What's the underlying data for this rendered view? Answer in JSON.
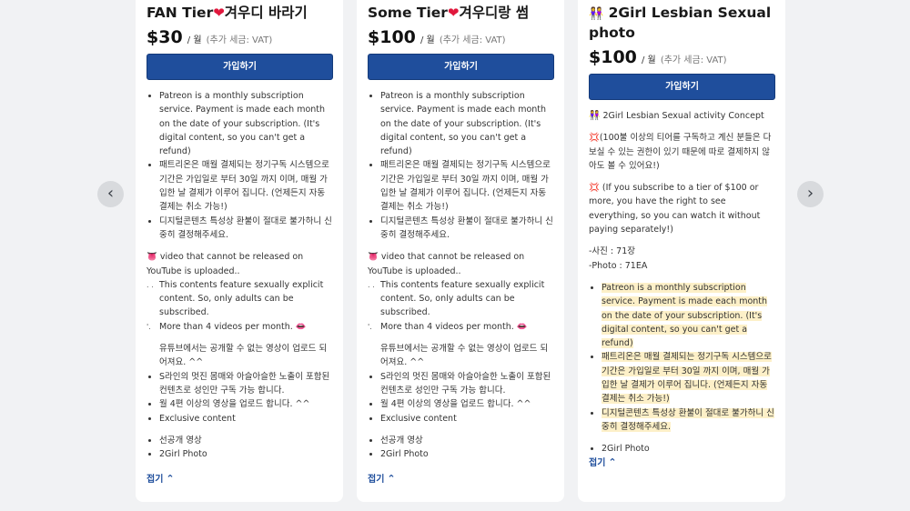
{
  "tiers": [
    {
      "title_text": "FAN Tier",
      "title_heart": "❤",
      "title_suffix": "겨우디 바라기",
      "price": "$30",
      "per": "/ 월",
      "vat": "(추가 세금: VAT)",
      "join_label": "가입하기",
      "bullets_a": [
        "Patreon is a monthly subscription service. Payment is made each month on the date of your subscription. (It's digital content, so you can't get a refund)",
        "패트리온은 매월 결제되는 정기구독 시스템으로 기간은 가입일로 부터 30일 까지 이며, 매월 가입한 날 결제가 이루어 집니다. (언제든지 자동결제는 취소 가능!)",
        "디지털콘텐츠 특성상 환불이 절대로 불가하니 신중히 결정해주세요."
      ],
      "video_line": " video that cannot be released on YouTube is uploaded..",
      "sub_a": "This contents feature sexually explicit content. So, only adults can be subscribed.",
      "sub_b": "More than 4 videos per month.",
      "korean_line": "유튜브에서는 공개할 수 없는  영상이 업로드 되어져요. ^^",
      "bullets_b": [
        "S라인의 멋진 몸매와 아슬아슬한 노출이 포함된 컨텐츠로 성인만 구독 가능 합니다.",
        "월 4편 이상의 영상을 업로드 합니다. ^^",
        "Exclusive content"
      ],
      "bullets_c": [
        "선공개 영상",
        "2Girl Photo"
      ],
      "collapse_label": "접기"
    },
    {
      "title_text": "Some Tier",
      "title_heart": "❤",
      "title_suffix": "겨우디랑 썸",
      "price": "$100",
      "per": "/ 월",
      "vat": "(추가 세금: VAT)",
      "join_label": "가입하기",
      "bullets_a": [
        "Patreon is a monthly subscription service. Payment is made each month on the date of your subscription. (It's digital content, so you can't get a refund)",
        "패트리온은 매월 결제되는 정기구독 시스템으로 기간은 가입일로 부터 30일 까지 이며, 매월 가입한 날 결제가 이루어 집니다. (언제든지 자동결제는 취소 가능!)",
        "디지털콘텐츠 특성상 환불이 절대로 불가하니 신중히 결정해주세요."
      ],
      "video_line": " video that cannot be released on YouTube is uploaded..",
      "sub_a": "This contents feature sexually explicit content. So, only adults can be subscribed.",
      "sub_b": "More than 4 videos per month.",
      "korean_line": "유튜브에서는 공개할 수 없는  영상이 업로드 되어져요. ^^",
      "bullets_b": [
        "S라인의 멋진 몸매와 아슬아슬한 노출이 포함된 컨텐츠로 성인만 구독 가능 합니다.",
        "월 4편 이상의 영상을 업로드 합니다. ^^",
        "Exclusive content"
      ],
      "bullets_c": [
        "선공개 영상",
        "2Girl Photo"
      ],
      "collapse_label": "접기"
    },
    {
      "title_text": "2Girl Lesbian Sexual photo",
      "price": "$100",
      "per": "/ 월",
      "vat": "(추가 세금: VAT)",
      "join_label": "가입하기",
      "concept": "2Girl Lesbian Sexual activity Concept",
      "korean_notice": "(100불 이상의 티어를 구독하고 계신 분들은 다 보실 수 있는 권한이 있기 때문에 따로 결제하지 않아도 볼 수 있어요!)",
      "english_notice": "(If you subscribe to a tier of $100 or more, you have the right to see everything, so you can watch it without paying separately!)",
      "photo_ko": "-사진 : 71장",
      "photo_en": "-Photo : 71EA",
      "bullets_a": [
        "Patreon is a monthly subscription service. Payment is made each month on the date of your subscription. (It's digital content, so you can't get a refund)",
        "패트리온은 매월 결제되는 정기구독 시스템으로 기간은 가입일로 부터 30일 까지 이며, 매월 가입한 날 결제가 이루어 집니다. (언제든지 자동결제는 취소 가능!)",
        "디지털콘텐츠 특성상 환불이 절대로 불가하니 신중히 결정해주세요."
      ],
      "bullets_c": [
        "2Girl Photo"
      ],
      "collapse_label": "접기"
    }
  ],
  "nav": {
    "prev": "‹",
    "next": "›"
  },
  "colors": {
    "button": "#1f4e9c",
    "highlight": "#fdf0c8",
    "accent": "#e0173c"
  }
}
